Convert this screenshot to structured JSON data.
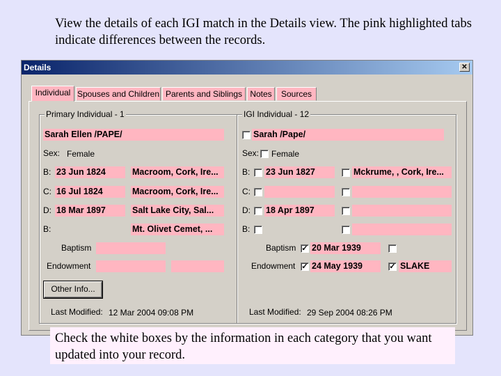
{
  "caption_top": "View the details of each IGI match in the Details view.  The pink highlighted tabs indicate differences between the records.",
  "window": {
    "title": "Details",
    "close_glyph": "✕"
  },
  "tabs": [
    {
      "label": "Individual",
      "active": true
    },
    {
      "label": "Spouses and Children"
    },
    {
      "label": "Parents and Siblings"
    },
    {
      "label": "Notes"
    },
    {
      "label": "Sources"
    }
  ],
  "primary": {
    "title": "Primary Individual - 1",
    "name": "Sarah Ellen /PAPE/",
    "sex_label": "Sex:",
    "sex_value": "Female",
    "events": [
      {
        "label": "B:",
        "date": "23 Jun 1824",
        "place": "Macroom, Cork, Ire..."
      },
      {
        "label": "C:",
        "date": "16 Jul 1824",
        "place": "Macroom, Cork, Ire..."
      },
      {
        "label": "D:",
        "date": "18 Mar 1897",
        "place": "Salt Lake City, Sal..."
      },
      {
        "label": "B:",
        "date": "",
        "place": "Mt. Olivet Cemet, ..."
      }
    ],
    "baptism_label": "Baptism",
    "endowment_label": "Endowment",
    "other_info_button": "Other Info...",
    "last_modified_label": "Last Modified:",
    "last_modified_value": "12 Mar 2004 09:08 PM"
  },
  "igi": {
    "title": "IGI Individual - 12",
    "name": "Sarah /Pape/",
    "sex_label": "Sex:",
    "sex_value": "Female",
    "events": [
      {
        "label": "B:",
        "date": "23 Jun 1827",
        "place": "Mckrume, , Cork, Ire..."
      },
      {
        "label": "C:",
        "date": "",
        "place": ""
      },
      {
        "label": "D:",
        "date": "18 Apr 1897",
        "place": ""
      },
      {
        "label": "B:",
        "date": "",
        "place": ""
      }
    ],
    "baptism_label": "Baptism",
    "baptism_date": "20 Mar 1939",
    "endowment_label": "Endowment",
    "endowment_date": "24 May 1939",
    "endowment_temple": "SLAKE",
    "check_glyph": "✓",
    "last_modified_label": "Last Modified:",
    "last_modified_value": "29 Sep 2004 08:26 PM"
  },
  "caption_bottom": "Check the white boxes by the information in each category that you want updated into your record."
}
